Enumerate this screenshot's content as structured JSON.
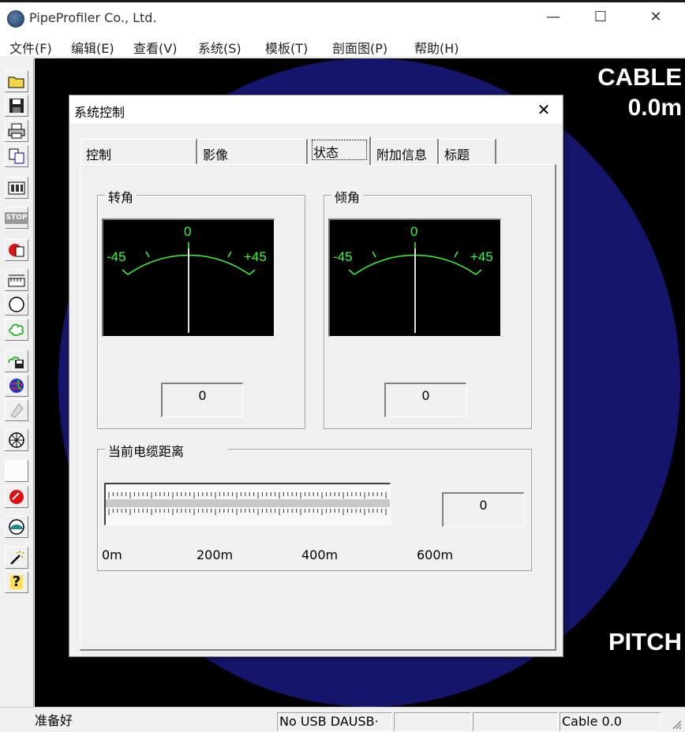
{
  "window": {
    "title": "PipeProfiler Co., Ltd.",
    "minimize_glyph": "—",
    "maximize_glyph": "☐",
    "close_glyph": "✕"
  },
  "menubar": [
    "文件(F)",
    "编辑(E)",
    "查看(V)",
    "系统(S)",
    "模板(T)",
    "剖面图(P)",
    "帮助(H)"
  ],
  "toolbar": {
    "icons": [
      "open-folder-icon",
      "save-disk-icon",
      "print-icon",
      "copy-icon",
      "film-frames-icon",
      "stop-icon",
      "record-icon",
      "ruler-icon",
      "circle-icon",
      "cloud-shape-icon",
      "save-capture-icon",
      "globe-icon",
      "diamond-tool-icon",
      "compass-icon",
      "blank-icon",
      "red-ball-icon",
      "dome-icon",
      "magic-wand-icon",
      "help-icon"
    ],
    "stop_text": "STOP"
  },
  "overlay": {
    "cable_label": "CABLE",
    "cable_value": "0.0m",
    "pitch_label": "PITCH"
  },
  "colors": {
    "overlay_circle": "#15156b",
    "gauge_green": "#33ff33",
    "viewport_bg": "#000000"
  },
  "dialog": {
    "title": "系统控制",
    "close_glyph": "✕",
    "tabs": [
      "控制",
      "影像",
      "状态",
      "附加信息",
      "标题"
    ],
    "active_tab": "状态",
    "roll_group": {
      "label": "转角",
      "value": "0",
      "gauge": {
        "min": "-45",
        "mid": "0",
        "max": "+45",
        "reading": 0
      }
    },
    "pitch_group": {
      "label": "倾角",
      "value": "0",
      "gauge": {
        "min": "-45",
        "mid": "0",
        "max": "+45",
        "reading": 0
      }
    },
    "cable_group": {
      "label": "当前电缆距离",
      "value": "0",
      "ruler_labels": [
        "0m",
        "200m",
        "400m",
        "600m"
      ]
    }
  },
  "statusbar": {
    "ready": "准备好",
    "usb": "No USB DAUSB·",
    "panel3": "",
    "panel4": "",
    "cable": "Cable 0.0"
  }
}
